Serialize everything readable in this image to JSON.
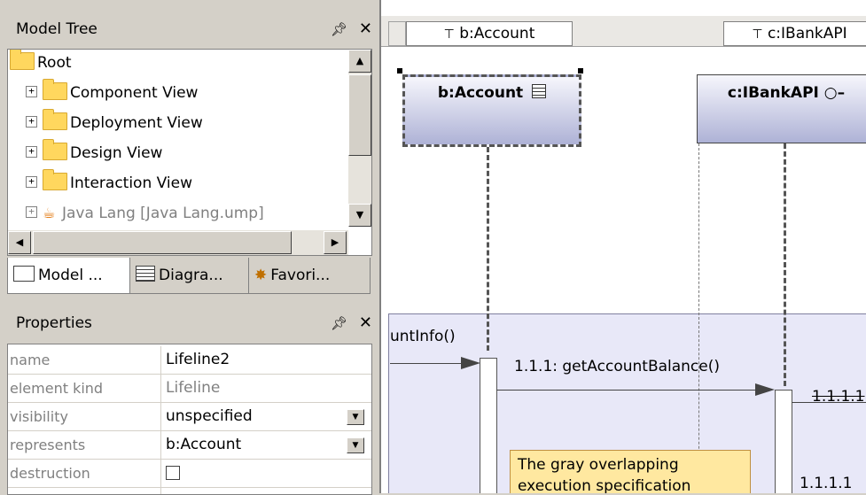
{
  "model_tree": {
    "title": "Model Tree",
    "pin_icon": "pin-icon",
    "close_icon": "close-icon",
    "items": [
      {
        "label": "Root",
        "level": 0,
        "icon": "folder-icon"
      },
      {
        "label": "Component View",
        "level": 1,
        "icon": "folder-icon"
      },
      {
        "label": "Deployment View",
        "level": 1,
        "icon": "folder-icon"
      },
      {
        "label": "Design View",
        "level": 1,
        "icon": "folder-icon"
      },
      {
        "label": "Interaction View",
        "level": 1,
        "icon": "folder-icon"
      },
      {
        "label": "Java Lang [Java Lang.ump]",
        "level": 1,
        "icon": "java-package-icon",
        "dimmed": true
      }
    ],
    "tabs": [
      {
        "label": "Model ...",
        "icon": "folder-icon",
        "active": true
      },
      {
        "label": "Diagra...",
        "icon": "diagram-tree-icon",
        "active": false
      },
      {
        "label": "Favori...",
        "icon": "favorites-icon",
        "active": false
      }
    ]
  },
  "properties": {
    "title": "Properties",
    "rows": [
      {
        "key": "name",
        "value": "Lifeline2",
        "gray": false,
        "dropdown": false
      },
      {
        "key": "element kind",
        "value": "Lifeline",
        "gray": true,
        "dropdown": false
      },
      {
        "key": "visibility",
        "value": "unspecified",
        "gray": false,
        "dropdown": true
      },
      {
        "key": "represents",
        "value": "b:Account",
        "gray": false,
        "dropdown": true
      },
      {
        "key": "destruction",
        "value": "",
        "gray": false,
        "checkbox": true
      }
    ]
  },
  "diagram": {
    "header_tabs": [
      "b:Account",
      "c:IBankAPI"
    ],
    "lifelines": [
      {
        "label": "b:Account",
        "selected": true
      },
      {
        "label": "c:IBankAPI"
      }
    ],
    "messages": [
      {
        "label": "untInfo()"
      },
      {
        "label": "1.1.1: getAccountBalance()"
      },
      {
        "label": "1.1.1.1"
      },
      {
        "label": "1.1.1.1"
      }
    ],
    "note": "The gray overlapping execution specification",
    "colors": {
      "frame_bg": "#e8e8f8",
      "note_bg": "#ffe8a0",
      "lifeline_gradient_end": "#aeb2d6"
    }
  }
}
